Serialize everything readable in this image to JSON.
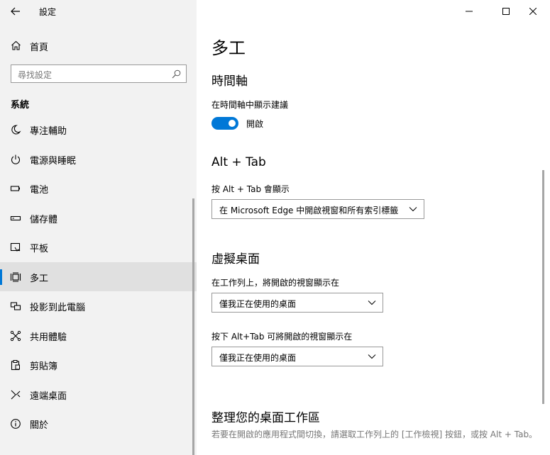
{
  "app": {
    "title": "設定"
  },
  "sidebar": {
    "home_label": "首頁",
    "search_placeholder": "尋找設定",
    "section_title": "系統",
    "items": [
      {
        "label": "專注輔助",
        "icon": "moon-icon"
      },
      {
        "label": "電源與睡眠",
        "icon": "power-icon"
      },
      {
        "label": "電池",
        "icon": "battery-icon"
      },
      {
        "label": "儲存體",
        "icon": "storage-icon"
      },
      {
        "label": "平板",
        "icon": "tablet-icon"
      },
      {
        "label": "多工",
        "icon": "multitasking-icon",
        "selected": true
      },
      {
        "label": "投影到此電腦",
        "icon": "project-icon"
      },
      {
        "label": "共用體驗",
        "icon": "shared-experiences-icon"
      },
      {
        "label": "剪貼簿",
        "icon": "clipboard-icon"
      },
      {
        "label": "遠端桌面",
        "icon": "remote-desktop-icon"
      },
      {
        "label": "關於",
        "icon": "info-icon"
      }
    ]
  },
  "main": {
    "title": "多工",
    "timeline": {
      "heading": "時間軸",
      "label": "在時間軸中顯示建議",
      "toggle_state": "開啟",
      "toggle_on": true
    },
    "alt_tab": {
      "heading": "Alt + Tab",
      "label": "按 Alt + Tab 會顯示",
      "value": "在 Microsoft Edge 中開啟視窗和所有索引標籤"
    },
    "virtual_desktops": {
      "heading": "虛擬桌面",
      "taskbar_label": "在工作列上，將開啟的視窗顯示在",
      "taskbar_value": "僅我正在使用的桌面",
      "alttab_label": "按下 Alt+Tab 可將開啟的視窗顯示在",
      "alttab_value": "僅我正在使用的桌面"
    },
    "workspace": {
      "heading": "整理您的桌面工作區",
      "description": "若要在開啟的應用程式間切換，請選取工作列上的 [工作檢視] 按鈕，或按 Alt + Tab。"
    }
  },
  "colors": {
    "accent": "#0078d7",
    "sidebar_bg": "#f2f2f2",
    "selected_bg": "#e0e0e0"
  }
}
